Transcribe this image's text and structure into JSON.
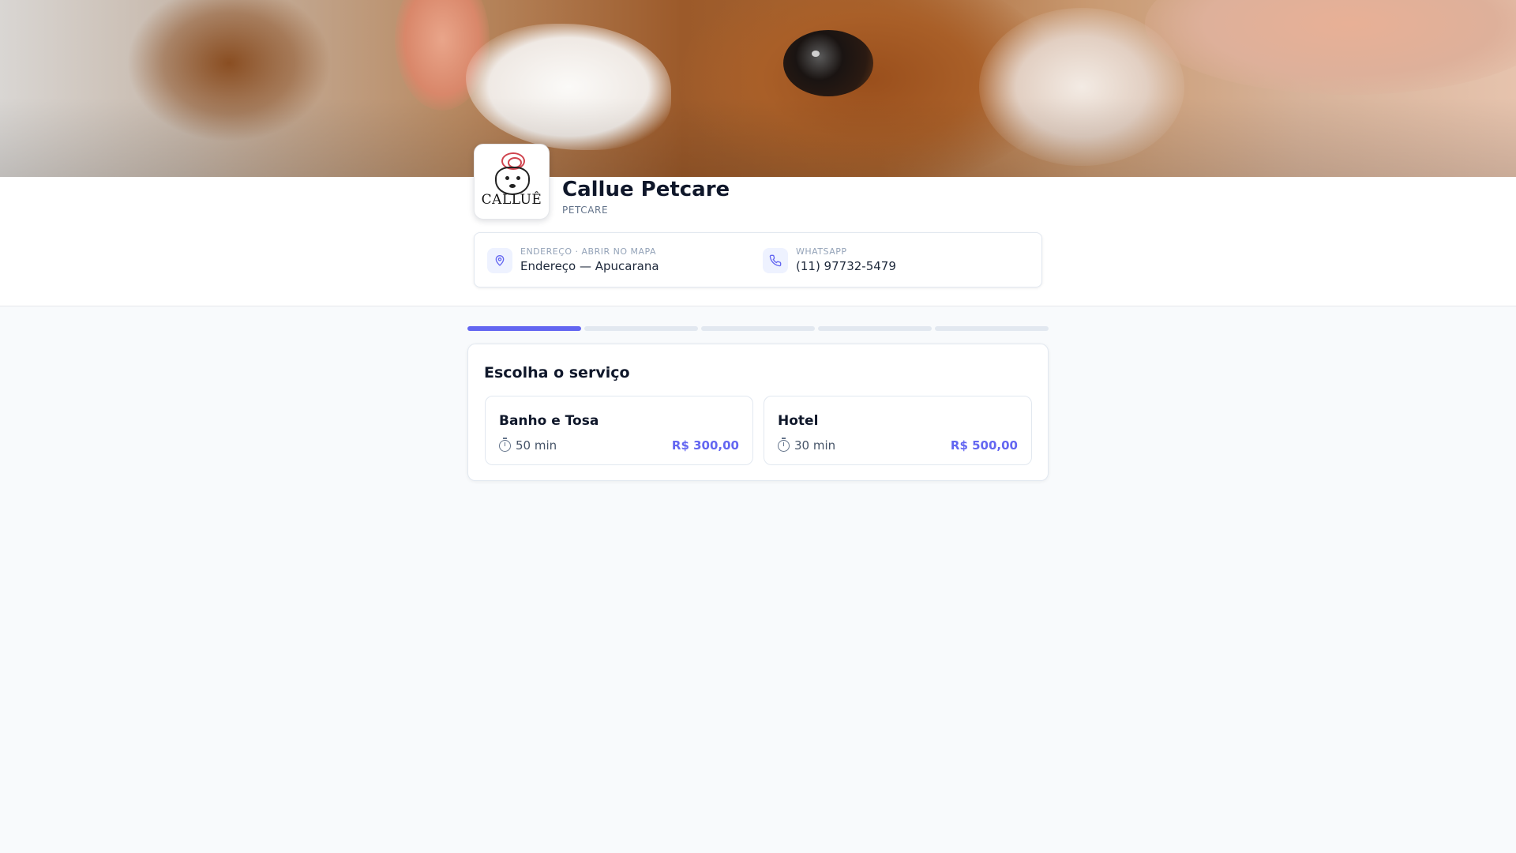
{
  "business": {
    "name": "Callue Petcare",
    "category": "PETCARE",
    "logo_text": "CALLUÊ"
  },
  "contact": {
    "address_label": "ENDEREÇO · ABRIR NO MAPA",
    "address_value": "Endereço — Apucarana",
    "address_icon": "map-pin-icon",
    "whatsapp_label": "WHATSAPP",
    "whatsapp_value": "(11) 97732-5479",
    "whatsapp_icon": "phone-icon"
  },
  "progress": {
    "total_steps": 5,
    "current_step": 1
  },
  "service_step": {
    "title": "Escolha o serviço",
    "services": [
      {
        "name": "Banho e Tosa",
        "duration": "50 min",
        "price": "R$ 300,00"
      },
      {
        "name": "Hotel",
        "duration": "30 min",
        "price": "R$ 500,00"
      }
    ]
  },
  "colors": {
    "accent": "#6366f1",
    "background": "#f8fafc"
  }
}
